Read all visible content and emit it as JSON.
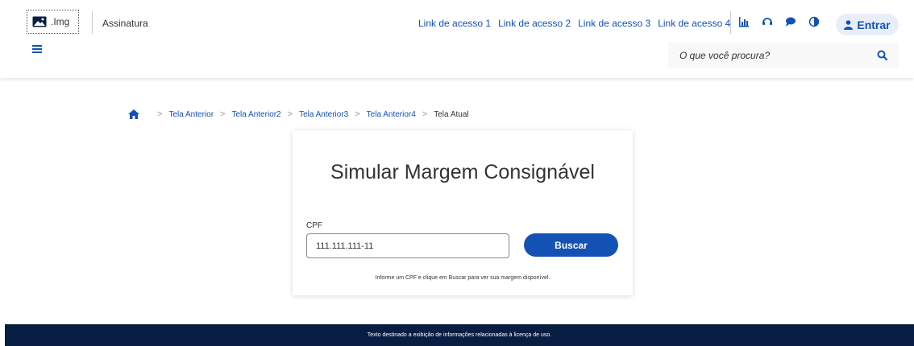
{
  "header": {
    "logo_text": ".Img",
    "signature": "Assinatura",
    "links": [
      "Link de acesso 1",
      "Link de acesso 2",
      "Link de acesso 3",
      "Link de acesso 4"
    ],
    "icons": [
      "chart-icon",
      "headset-icon",
      "chat-icon",
      "contrast-icon"
    ],
    "login_label": "Entrar",
    "search_placeholder": "O que você procura?"
  },
  "breadcrumb": {
    "items": [
      "Tela Anterior",
      "Tela Anterior2",
      "Tela Anterior3",
      "Tela Anterior4"
    ],
    "current": "Tela Atual"
  },
  "form": {
    "title": "Simular Margem Consignável",
    "cpf_label": "CPF",
    "cpf_value": "111.111.111-11",
    "button_label": "Buscar",
    "hint": "Informe um CPF e clique em Buscar para ver sua margem disponível."
  },
  "footer": {
    "text": "Texto destinado a exibição de informações relacionadas à licença de uso."
  },
  "colors": {
    "primary": "#1351b4",
    "footer_bg": "#071d41"
  }
}
